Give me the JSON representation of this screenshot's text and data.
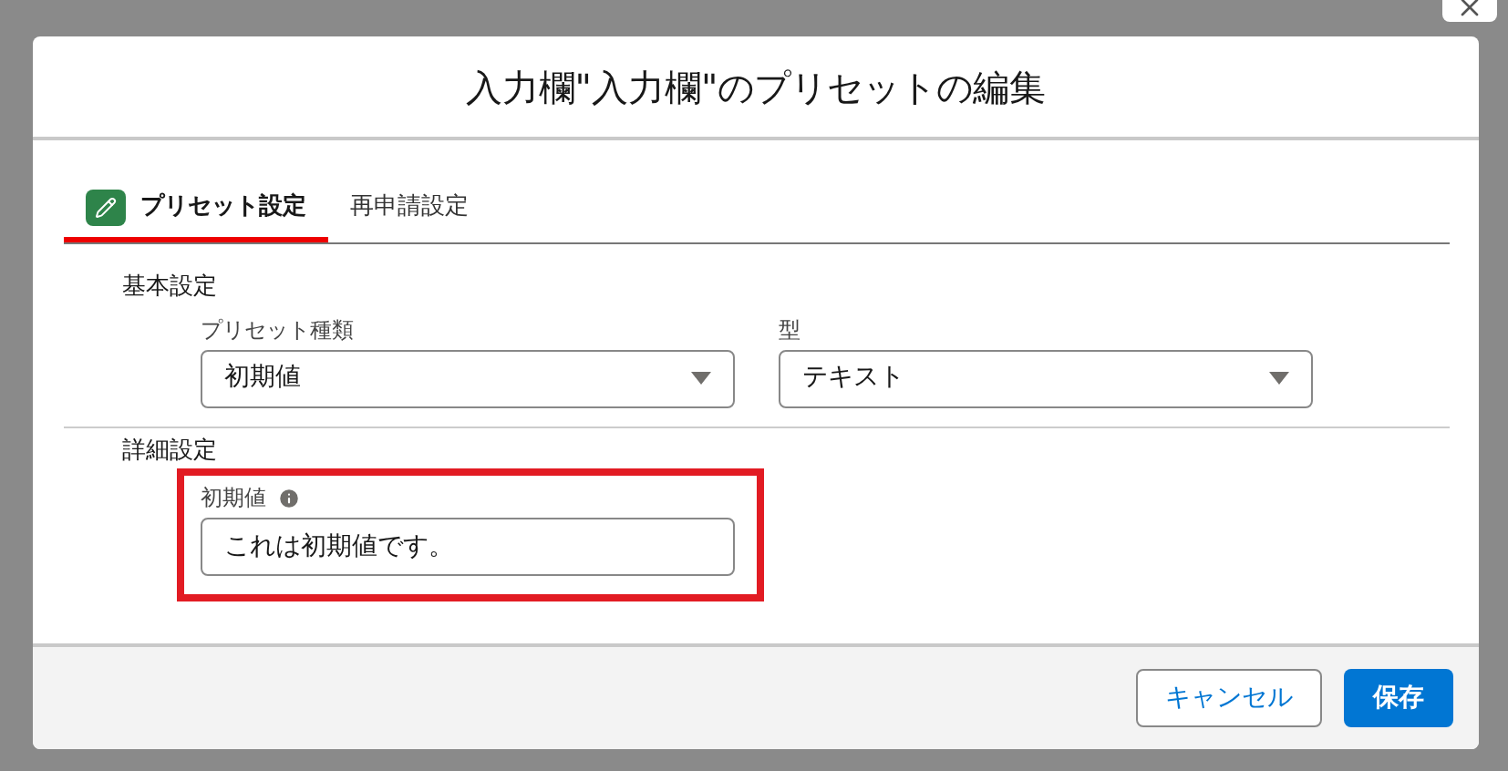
{
  "dialog": {
    "title": "入力欄\"入力欄\"のプリセットの編集",
    "tabs": [
      {
        "label": "プリセット設定",
        "selected": true
      },
      {
        "label": "再申請設定",
        "selected": false
      }
    ],
    "sections": [
      {
        "title": "基本設定",
        "highlighted": false,
        "fields": [
          {
            "kind": "select",
            "label": "プリセット種類",
            "value": "初期値",
            "info": false
          },
          {
            "kind": "select",
            "label": "型",
            "value": "テキスト",
            "info": false
          }
        ]
      },
      {
        "title": "詳細設定",
        "highlighted": true,
        "fields": [
          {
            "kind": "text",
            "label": "初期値",
            "value": "これは初期値です。",
            "info": true
          }
        ]
      }
    ],
    "buttons": [
      {
        "label": "キャンセル",
        "kind": "neutral"
      },
      {
        "label": "保存",
        "kind": "brand"
      }
    ]
  }
}
